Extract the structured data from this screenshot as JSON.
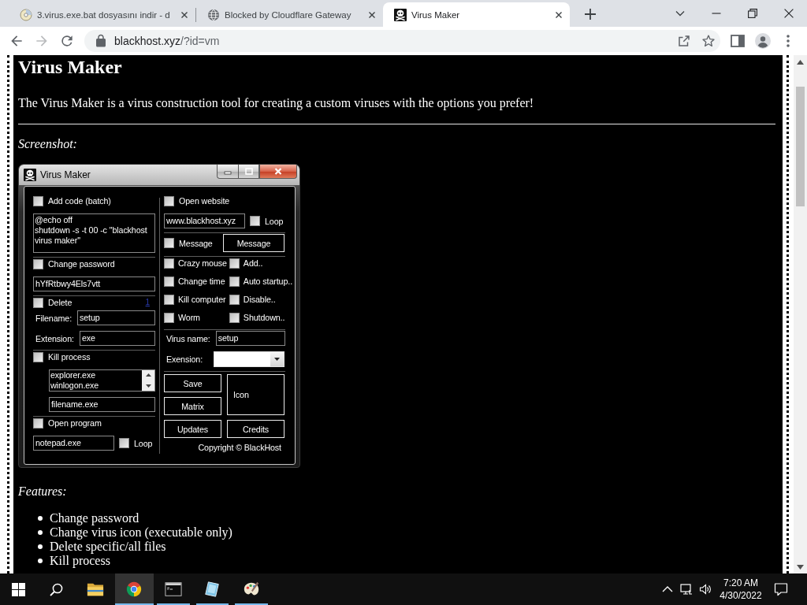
{
  "browser": {
    "tabs": [
      {
        "title": "3.virus.exe.bat dosyasını indir - d",
        "selected": false
      },
      {
        "title": "Blocked by Cloudflare Gateway",
        "selected": false
      },
      {
        "title": "Virus Maker",
        "selected": true
      }
    ],
    "nav_buttons": [
      {
        "kind": "back",
        "disabled": false
      },
      {
        "kind": "forward",
        "disabled": true
      },
      {
        "kind": "reload",
        "disabled": false
      }
    ],
    "address": {
      "host": "blackhost.xyz",
      "path": "/?id=vm"
    }
  },
  "page": {
    "heading": "Virus Maker",
    "intro": "The Virus Maker is a virus construction tool for creating a custom viruses with the options you prefer!",
    "screenshot_label": "Screenshot:",
    "app_window": {
      "title": "Virus Maker",
      "left_groups": [
        [
          {
            "kind": "check",
            "label": "Add code (batch)",
            "checked": false
          },
          {
            "kind": "textarea",
            "value": "@echo off\nshutdown -s -t 00 -c \"blackhost virus maker\""
          }
        ],
        [
          {
            "kind": "check",
            "label": "Change password",
            "checked": false
          },
          {
            "kind": "input",
            "value": "hYfRtbwy4Els7vtt"
          }
        ],
        [
          {
            "kind": "check",
            "label": "Delete",
            "checked": false,
            "link": "1"
          },
          {
            "kind": "labeled_input",
            "label": "Filename:",
            "value": "setup"
          },
          {
            "kind": "labeled_input",
            "label": "Extension:",
            "value": "exe"
          }
        ],
        [
          {
            "kind": "check",
            "label": "Kill process",
            "checked": false
          },
          {
            "kind": "process_list",
            "items": [
              "explorer.exe",
              "winlogon.exe"
            ],
            "value": "filename.exe"
          }
        ],
        [
          {
            "kind": "check",
            "label": "Open program",
            "checked": false
          },
          {
            "kind": "input_check",
            "value": "notepad.exe",
            "option": {
              "label": "Loop",
              "checked": false
            }
          }
        ]
      ],
      "right_groups": [
        [
          {
            "kind": "check",
            "label": "Open website",
            "checked": false
          },
          {
            "kind": "input_check",
            "value": "www.blackhost.xyz",
            "option": {
              "label": "Loop",
              "checked": false
            }
          }
        ],
        [
          {
            "kind": "check_button",
            "label": "Message",
            "checked": false,
            "button": "Message"
          }
        ],
        [
          {
            "kind": "check_grid",
            "items": [
              {
                "label": "Crazy mouse",
                "checked": false
              },
              {
                "label": "Add..",
                "checked": false
              },
              {
                "label": "Change time",
                "checked": false
              },
              {
                "label": "Auto startup..",
                "checked": false
              },
              {
                "label": "Kill computer",
                "checked": false
              },
              {
                "label": "Disable..",
                "checked": false
              },
              {
                "label": "Worm",
                "checked": false
              },
              {
                "label": "Shutdown..",
                "checked": false
              }
            ]
          }
        ],
        [
          {
            "kind": "labeled_input",
            "label": "Virus name:",
            "value": "setup"
          },
          {
            "kind": "dropdown",
            "label": "Exension:"
          }
        ],
        [
          {
            "kind": "button_grid",
            "buttons": [
              {
                "kind": "button",
                "label": "Save"
              },
              {
                "kind": "preview",
                "label": "Icon"
              },
              {
                "kind": "button",
                "label": "Matrix"
              },
              {
                "kind": "button",
                "label": "Updates"
              },
              {
                "kind": "button",
                "label": "Credits"
              }
            ]
          },
          {
            "kind": "copyright",
            "text": "Copyright © BlackHost"
          }
        ]
      ]
    },
    "features_label": "Features:",
    "features": [
      "Change password",
      "Change virus icon (executable only)",
      "Delete specific/all files",
      "Kill process"
    ]
  },
  "taskbar": {
    "apps": [
      {
        "running": false,
        "selected": false
      },
      {
        "running": true,
        "selected": true
      },
      {
        "running": true,
        "selected": false
      },
      {
        "running": true,
        "selected": false
      },
      {
        "running": true,
        "selected": false
      }
    ],
    "time": "7:20 AM",
    "date": "4/30/2022"
  }
}
